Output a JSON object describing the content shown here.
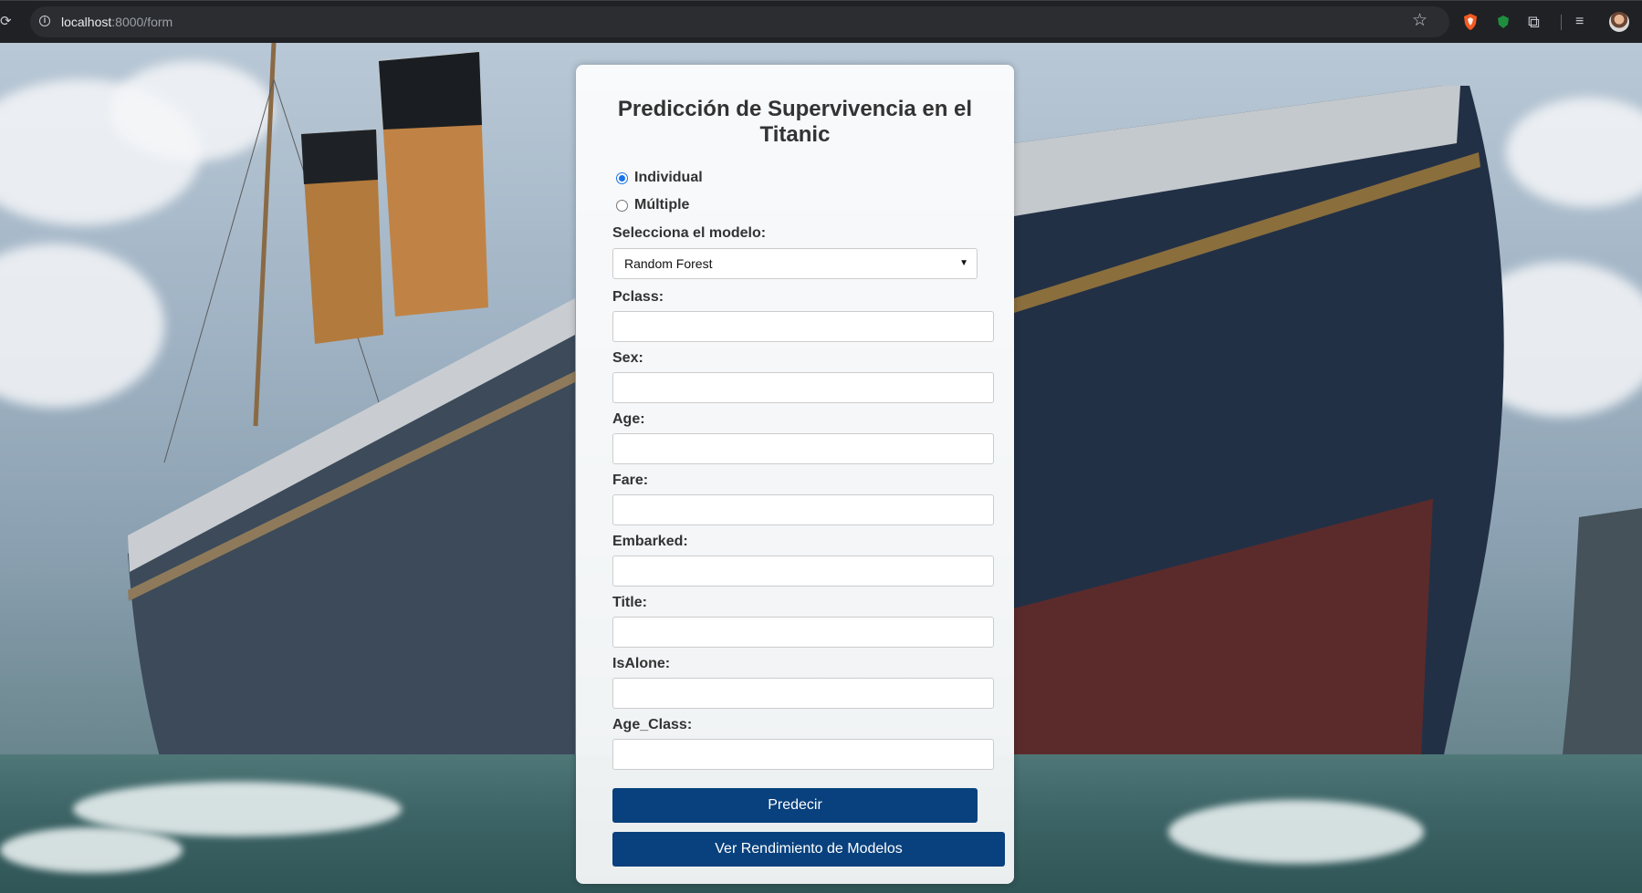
{
  "browser": {
    "url_host": "localhost",
    "url_path": ":8000/form"
  },
  "form": {
    "title": "Predicción de Supervivencia en el Titanic",
    "mode_options": [
      {
        "label": "Individual",
        "selected": true
      },
      {
        "label": "Múltiple",
        "selected": false
      }
    ],
    "model_label": "Selecciona el modelo:",
    "model_selected": "Random Forest",
    "fields": [
      {
        "label": "Pclass:",
        "value": ""
      },
      {
        "label": "Sex:",
        "value": ""
      },
      {
        "label": "Age:",
        "value": ""
      },
      {
        "label": "Fare:",
        "value": ""
      },
      {
        "label": "Embarked:",
        "value": ""
      },
      {
        "label": "Title:",
        "value": ""
      },
      {
        "label": "IsAlone:",
        "value": ""
      },
      {
        "label": "Age_Class:",
        "value": ""
      }
    ],
    "predict_button": "Predecir",
    "performance_button": "Ver Rendimiento de Modelos"
  },
  "colors": {
    "button_bg": "#08417d",
    "radio_accent": "#1a73e8",
    "browser_bar": "#202124"
  }
}
